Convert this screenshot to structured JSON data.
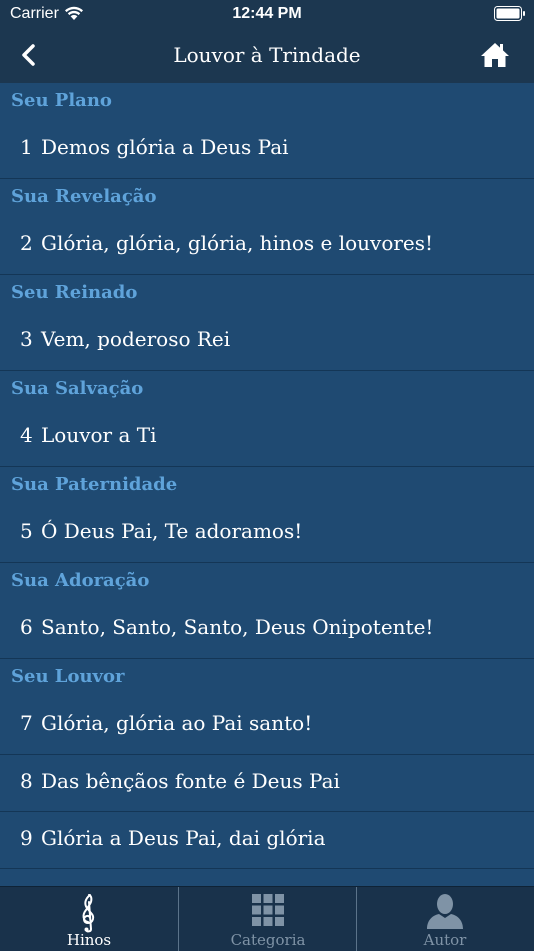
{
  "status": {
    "carrier": "Carrier",
    "time": "12:44 PM"
  },
  "nav": {
    "title": "Louvor à Trindade"
  },
  "sections": [
    {
      "header": "Seu Plano",
      "rows": [
        {
          "num": "1",
          "title": "Demos glória a Deus Pai"
        }
      ]
    },
    {
      "header": "Sua Revelação",
      "rows": [
        {
          "num": "2",
          "title": "Glória, glória, glória, hinos e louvores!"
        }
      ]
    },
    {
      "header": "Seu Reinado",
      "rows": [
        {
          "num": "3",
          "title": "Vem, poderoso Rei"
        }
      ]
    },
    {
      "header": "Sua Salvação",
      "rows": [
        {
          "num": "4",
          "title": "Louvor a Ti"
        }
      ]
    },
    {
      "header": "Sua Paternidade",
      "rows": [
        {
          "num": "5",
          "title": "Ó Deus Pai, Te adoramos!"
        }
      ]
    },
    {
      "header": "Sua Adoração",
      "rows": [
        {
          "num": "6",
          "title": "Santo, Santo, Santo, Deus Onipotente!"
        }
      ]
    },
    {
      "header": "Seu Louvor",
      "rows": [
        {
          "num": "7",
          "title": "Glória, glória ao Pai santo!"
        },
        {
          "num": "8",
          "title": "Das bênçãos fonte é Deus Pai"
        },
        {
          "num": "9",
          "title": "Glória a Deus Pai, dai glória"
        }
      ]
    }
  ],
  "tabs": [
    {
      "label": "Hinos",
      "icon": "treble-clef-icon",
      "active": true
    },
    {
      "label": "Categoria",
      "icon": "grid-icon",
      "active": false
    },
    {
      "label": "Autor",
      "icon": "person-icon",
      "active": false
    }
  ],
  "colors": {
    "background": "#1f4a72",
    "bar": "#1c3750",
    "section_header": "#5fa3da"
  }
}
